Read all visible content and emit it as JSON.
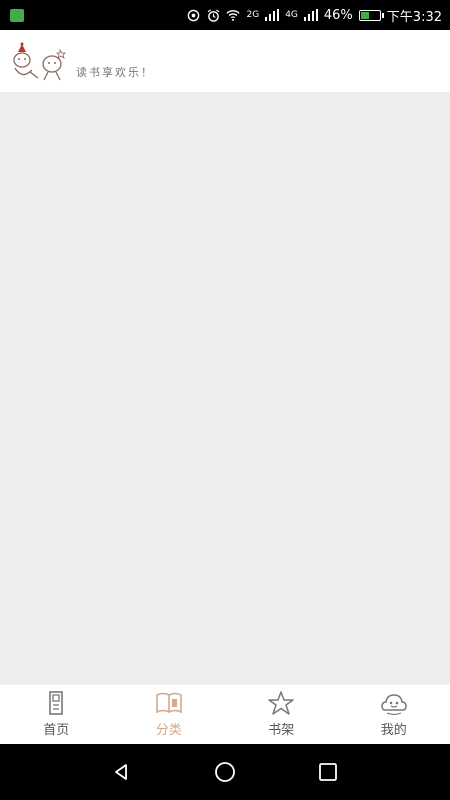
{
  "status_bar": {
    "time": "下午3:32",
    "battery_percent": "46%",
    "signal_1": "2G",
    "signal_2": "4G",
    "battery_level": 0.46,
    "icons": [
      "app-notification-icon",
      "sync-icon",
      "alarm-icon",
      "wifi-icon",
      "signal-icon",
      "signal-icon",
      "battery-icon"
    ]
  },
  "header": {
    "tagline": "读书享欢乐！"
  },
  "bottom_nav": {
    "items": [
      {
        "label": "首页",
        "icon": "home-icon",
        "active": false
      },
      {
        "label": "分类",
        "icon": "book-icon",
        "active": true
      },
      {
        "label": "书架",
        "icon": "star-icon",
        "active": false
      },
      {
        "label": "我的",
        "icon": "profile-icon",
        "active": false
      }
    ]
  },
  "colors": {
    "accent": "#d4a98a",
    "content_bg": "#eeeeee",
    "nav_text": "#555555"
  }
}
